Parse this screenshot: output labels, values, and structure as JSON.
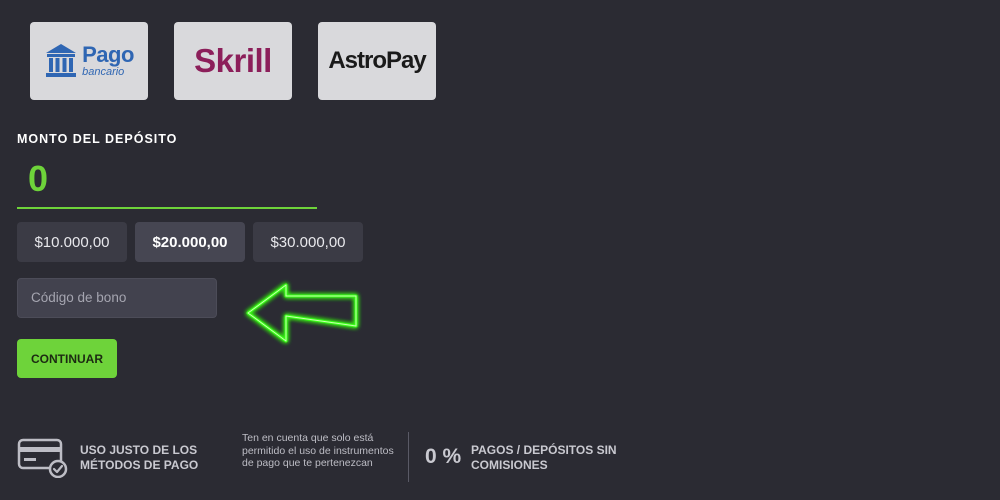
{
  "payment_methods": [
    {
      "name": "Pago",
      "subtitle": "bancario"
    },
    {
      "name": "Skrill"
    },
    {
      "name": "AstroPay"
    }
  ],
  "deposit": {
    "label": "MONTO DEL DEPÓSITO",
    "value": "0"
  },
  "presets": [
    "$10.000,00",
    "$20.000,00",
    "$30.000,00"
  ],
  "bonus": {
    "placeholder": "Código de bono"
  },
  "continue_label": "CONTINUAR",
  "footer": {
    "fair_use_title": "USO JUSTO DE LOS MÉTODOS DE PAGO",
    "fair_use_note": "Ten en cuenta que solo está permitido el uso de instrumentos de pago que te pertenezcan",
    "zero_percent": "0 %",
    "commission_text": "PAGOS / DEPÓSITOS SIN COMISIONES"
  },
  "colors": {
    "background": "#2b2b33",
    "accent": "#6ed33a",
    "card": "#d9d9dc",
    "skrill": "#8c1f5a",
    "bank_blue": "#2f66b3"
  },
  "icons": {
    "bank": "bank-icon",
    "card": "credit-card-check-icon",
    "arrow": "arrow-left-icon"
  }
}
